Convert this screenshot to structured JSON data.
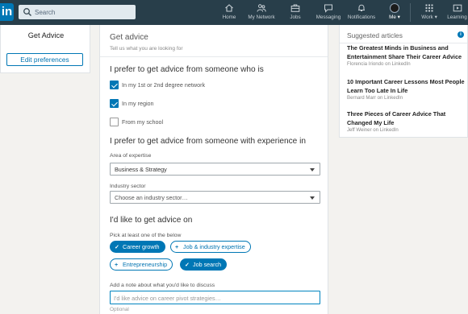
{
  "nav": {
    "logo": "in",
    "search_placeholder": "Search",
    "items": [
      {
        "label": "Home",
        "icon": "home-icon"
      },
      {
        "label": "My Network",
        "icon": "people-icon"
      },
      {
        "label": "Jobs",
        "icon": "briefcase-icon"
      },
      {
        "label": "Messaging",
        "icon": "messaging-icon"
      },
      {
        "label": "Notifications",
        "icon": "bell-icon"
      },
      {
        "label": "Me ▾",
        "icon": "avatar"
      },
      {
        "label": "Work ▾",
        "icon": "grid-icon"
      },
      {
        "label": "Learning",
        "icon": "learning-icon"
      }
    ]
  },
  "left": {
    "title": "Get Advice",
    "edit_label": "Edit preferences"
  },
  "main": {
    "title": "Get advice",
    "subtitle": "Tell us what you are looking for",
    "section1": {
      "heading": "I prefer to get advice from someone who is",
      "options": [
        {
          "label": "In my 1st or 2nd degree network",
          "checked": true
        },
        {
          "label": "In my region",
          "checked": true
        },
        {
          "label": "From my school",
          "checked": false
        }
      ]
    },
    "section2": {
      "heading": "I prefer to get advice from someone with experience in",
      "expertise_label": "Area of expertise",
      "expertise_value": "Business & Strategy",
      "industry_label": "Industry sector",
      "industry_value": "Choose an industry sector…"
    },
    "section3": {
      "heading": "I'd like to get advice on",
      "hint": "Pick at least one of the below",
      "topics": [
        {
          "label": "Career growth",
          "selected": true
        },
        {
          "label": "Job & industry expertise",
          "selected": false
        },
        {
          "label": "Entrepreneurship",
          "selected": false
        },
        {
          "label": "Job search",
          "selected": true
        }
      ]
    },
    "note_label": "Add a note about what you'd like to discuss",
    "note_placeholder": "I'd like advice on career pivot strategies…",
    "optional": "Optional"
  },
  "right": {
    "heading": "Suggested articles",
    "info_glyph": "i",
    "articles": [
      {
        "title": "The Greatest Minds in Business and Entertainment Share Their Career Advice",
        "source": "Florencia Iriondo on LinkedIn"
      },
      {
        "title": "10 Important Career Lessons Most People Learn Too Late In Life",
        "source": "Bernard Marr on LinkedIn"
      },
      {
        "title": "Three Pieces of Career Advice That Changed My Life",
        "source": "Jeff Weiner on LinkedIn"
      }
    ]
  },
  "colors": {
    "nav_bg": "#283e4a",
    "brand": "#0077b5",
    "page_bg": "#f3f2ef"
  }
}
